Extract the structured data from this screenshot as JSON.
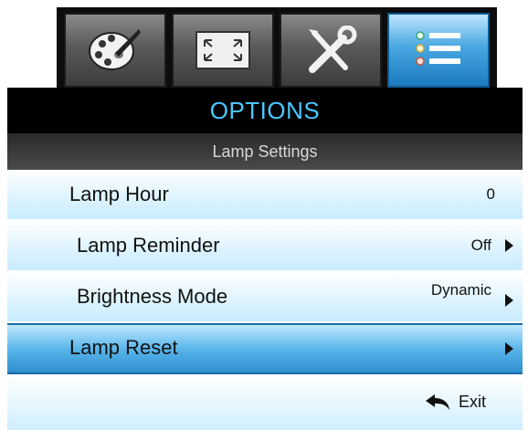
{
  "tabs": [
    {
      "icon": "palette-icon"
    },
    {
      "icon": "display-fullscreen-icon"
    },
    {
      "icon": "tools-icon"
    },
    {
      "icon": "options-list-icon",
      "active": true
    }
  ],
  "header": {
    "title": "OPTIONS",
    "subtitle": "Lamp Settings"
  },
  "menu": {
    "lamp_hour": {
      "label": "Lamp Hour",
      "value": "0"
    },
    "lamp_reminder": {
      "label": "Lamp Reminder",
      "value": "Off"
    },
    "brightness_mode": {
      "label": "Brightness Mode",
      "value": "Dynamic"
    },
    "lamp_reset": {
      "label": "Lamp Reset"
    }
  },
  "footer": {
    "exit_label": "Exit",
    "exit_icon": "return-arrow-icon"
  },
  "colors": {
    "title": "#4cc8ff",
    "active_tab": "#48a8e0",
    "selected_row": "#5ab6ea"
  }
}
